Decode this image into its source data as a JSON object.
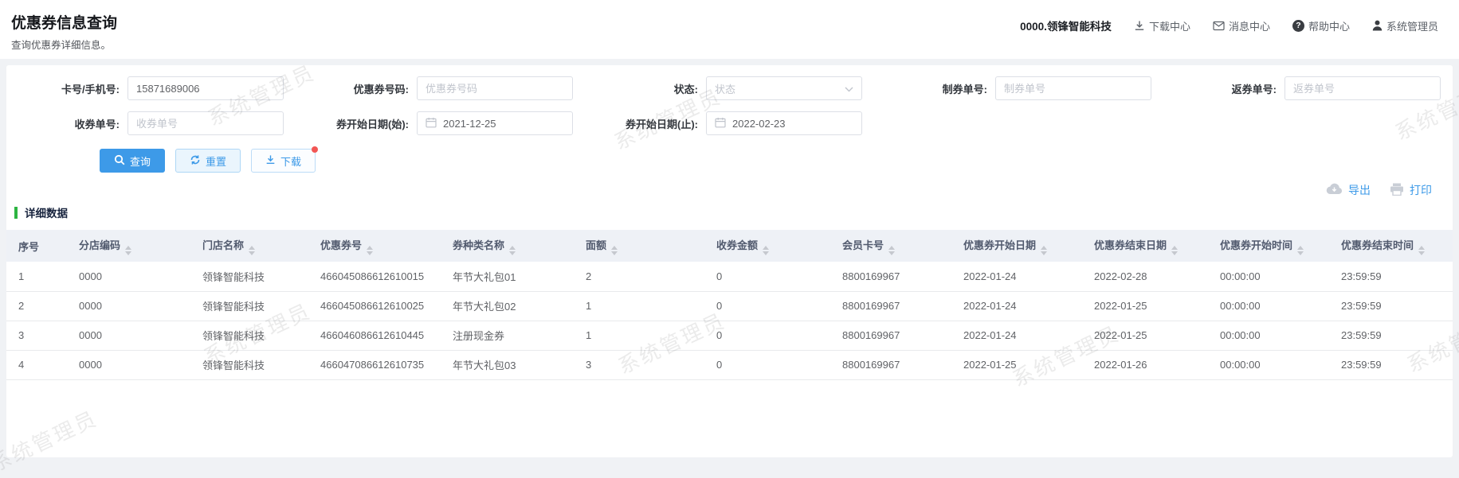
{
  "page": {
    "title": "优惠券信息查询",
    "subtitle": "查询优惠券详细信息。"
  },
  "topbar": {
    "company": "0000.领锋智能科技",
    "links": [
      {
        "label": "下载中心",
        "icon": "download-icon"
      },
      {
        "label": "消息中心",
        "icon": "message-icon"
      },
      {
        "label": "帮助中心",
        "icon": "help-icon"
      },
      {
        "label": "系统管理员",
        "icon": "user-icon"
      }
    ]
  },
  "search_form": {
    "fields": {
      "card_no": {
        "label": "卡号/手机号:",
        "value": "15871689006"
      },
      "coupon_no": {
        "label": "优惠券号码:",
        "placeholder": "优惠券号码"
      },
      "status": {
        "label": "状态:",
        "placeholder": "状态"
      },
      "make_order": {
        "label": "制券单号:",
        "placeholder": "制券单号"
      },
      "return_order": {
        "label": "返券单号:",
        "placeholder": "返券单号"
      },
      "receive_order": {
        "label": "收券单号:",
        "placeholder": "收券单号"
      },
      "start_date_from": {
        "label": "券开始日期(始):",
        "value": "2021-12-25"
      },
      "start_date_to": {
        "label": "券开始日期(止):",
        "value": "2022-02-23"
      }
    },
    "buttons": {
      "query": "查询",
      "reset": "重置",
      "download": "下载"
    }
  },
  "toolbar": {
    "export": "导出",
    "print": "打印"
  },
  "section": {
    "title": "详细数据"
  },
  "table": {
    "columns": [
      {
        "label": "序号",
        "sortable": false
      },
      {
        "label": "分店编码",
        "sortable": true
      },
      {
        "label": "门店名称",
        "sortable": true
      },
      {
        "label": "优惠券号",
        "sortable": true
      },
      {
        "label": "券种类名称",
        "sortable": true
      },
      {
        "label": "面额",
        "sortable": true
      },
      {
        "label": "收券金额",
        "sortable": true
      },
      {
        "label": "会员卡号",
        "sortable": true
      },
      {
        "label": "优惠券开始日期",
        "sortable": true
      },
      {
        "label": "优惠券结束日期",
        "sortable": true
      },
      {
        "label": "优惠券开始时间",
        "sortable": true
      },
      {
        "label": "优惠券结束时间",
        "sortable": true
      }
    ],
    "rows": [
      [
        "1",
        "0000",
        "领锋智能科技",
        "466045086612610015",
        "年节大礼包01",
        "2",
        "0",
        "8800169967",
        "2022-01-24",
        "2022-02-28",
        "00:00:00",
        "23:59:59"
      ],
      [
        "2",
        "0000",
        "领锋智能科技",
        "466045086612610025",
        "年节大礼包02",
        "1",
        "0",
        "8800169967",
        "2022-01-24",
        "2022-01-25",
        "00:00:00",
        "23:59:59"
      ],
      [
        "3",
        "0000",
        "领锋智能科技",
        "466046086612610445",
        "注册现金券",
        "1",
        "0",
        "8800169967",
        "2022-01-24",
        "2022-01-25",
        "00:00:00",
        "23:59:59"
      ],
      [
        "4",
        "0000",
        "领锋智能科技",
        "466047086612610735",
        "年节大礼包03",
        "3",
        "0",
        "8800169967",
        "2022-01-25",
        "2022-01-26",
        "00:00:00",
        "23:59:59"
      ]
    ]
  },
  "watermark": {
    "text": "系统管理员"
  },
  "colors": {
    "primary": "#3d9ae8",
    "section_green": "#2db442",
    "notify_dot": "#f25654",
    "table_header_bg": "#eef1f6"
  }
}
